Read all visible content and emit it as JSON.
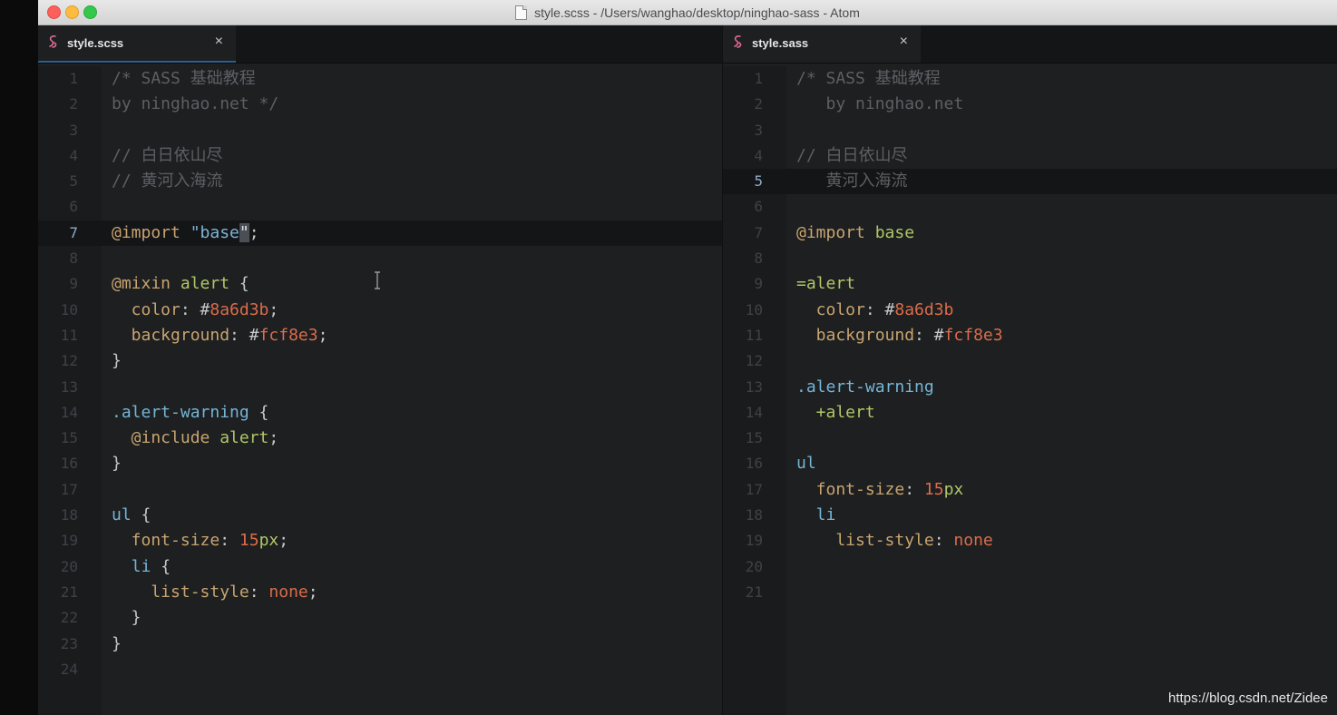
{
  "window": {
    "title": "style.scss - /Users/wanghao/desktop/ninghao-sass - Atom"
  },
  "left_pane": {
    "tab": {
      "label": "style.scss",
      "close": "×"
    },
    "current_line": 7,
    "line_numbers": [
      "1",
      "2",
      "3",
      "4",
      "5",
      "6",
      "7",
      "8",
      "9",
      "10",
      "11",
      "12",
      "13",
      "14",
      "15",
      "16",
      "17",
      "18",
      "19",
      "20",
      "21",
      "22",
      "23",
      "24"
    ],
    "code": {
      "l1": "/* SASS 基础教程",
      "l2": "by ninghao.net */",
      "l4": "// 白日依山尽",
      "l5": "// 黄河入海流",
      "l7_at": "@import",
      "l7_q1": " \"base",
      "l7_cursor": "\"",
      "l7_end": ";",
      "l9_at": "@mixin",
      "l9_name": " alert",
      "l9_brace": " {",
      "l10_prop": "  color",
      "l10_colon": ": #",
      "l10_val": "8a6d3b",
      "l10_end": ";",
      "l11_prop": "  background",
      "l11_colon": ": #",
      "l11_val": "fcf8e3",
      "l11_end": ";",
      "l12": "}",
      "l14_sel": ".alert-warning",
      "l14_brace": " {",
      "l15_at": "  @include",
      "l15_name": " alert",
      "l15_end": ";",
      "l16": "}",
      "l18_sel": "ul",
      "l18_brace": " {",
      "l19_prop": "  font-size",
      "l19_colon": ": ",
      "l19_num": "15",
      "l19_unit": "px",
      "l19_end": ";",
      "l20_sel": "  li",
      "l20_brace": " {",
      "l21_prop": "    list-style",
      "l21_colon": ": ",
      "l21_val": "none",
      "l21_end": ";",
      "l22": "  }",
      "l23": "}"
    }
  },
  "right_pane": {
    "tab": {
      "label": "style.sass",
      "close": "×"
    },
    "current_line": 5,
    "line_numbers": [
      "1",
      "2",
      "3",
      "4",
      "5",
      "6",
      "7",
      "8",
      "9",
      "10",
      "11",
      "12",
      "13",
      "14",
      "15",
      "16",
      "17",
      "18",
      "19",
      "20",
      "21"
    ],
    "code": {
      "l1": "/* SASS 基础教程",
      "l2": "   by ninghao.net",
      "l4": "// 白日依山尽",
      "l5": "   黄河入海流",
      "l7_at": "@import",
      "l7_name": " base",
      "l9": "=alert",
      "l10_prop": "  color",
      "l10_colon": ": #",
      "l10_val": "8a6d3b",
      "l11_prop": "  background",
      "l11_colon": ": #",
      "l11_val": "fcf8e3",
      "l13": ".alert-warning",
      "l14": "  +alert",
      "l16": "ul",
      "l17_prop": "  font-size",
      "l17_colon": ": ",
      "l17_num": "15",
      "l17_unit": "px",
      "l18": "  li",
      "l19_prop": "    list-style",
      "l19_colon": ": ",
      "l19_val": "none"
    }
  },
  "watermark": "https://blog.csdn.net/Zidee",
  "colors": {
    "editor_bg": "#1d1f21",
    "comment": "#5c6064",
    "keyword_green": "#b0c866",
    "selector_blue": "#76b5d6",
    "value_red": "#db6c4a",
    "property_tan": "#c9a46f"
  }
}
